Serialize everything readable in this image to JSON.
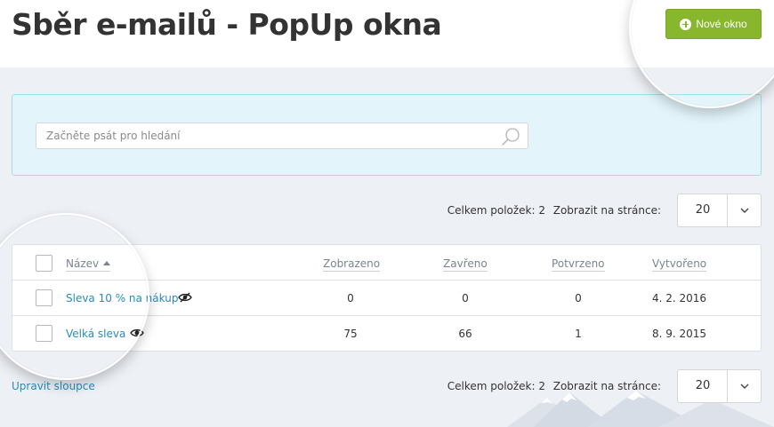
{
  "header": {
    "title": "Sběr e-mailů - PopUp okna",
    "new_button_label": "Nové okno"
  },
  "search": {
    "placeholder": "Začněte psát pro hledání",
    "value": ""
  },
  "pager_top": {
    "total_label": "Celkem položek: 2",
    "per_page_label": "Zobrazit na stránce:",
    "per_page_value": "20"
  },
  "pager_bottom": {
    "total_label": "Celkem položek: 2",
    "per_page_label": "Zobrazit na stránce:",
    "per_page_value": "20"
  },
  "table": {
    "columns": [
      "Název",
      "Zobrazeno",
      "Zavřeno",
      "Potvrzeno",
      "Vytvořeno"
    ],
    "sort_column": "Název",
    "rows": [
      {
        "name": "Sleva 10 % na nákup",
        "visibility_icon": "eye-crossed-icon",
        "shown": "0",
        "closed": "0",
        "confirmed": "0",
        "created": "4. 2. 2016"
      },
      {
        "name": "Velká sleva",
        "visibility_icon": "eye-icon",
        "shown": "75",
        "closed": "66",
        "confirmed": "1",
        "created": "8. 9. 2015"
      }
    ]
  },
  "footer": {
    "edit_columns_label": "Upravit sloupce"
  },
  "colors": {
    "accent_green": "#88b72e",
    "link_blue": "#2a8cb8",
    "search_panel_bg": "#e3f5fb",
    "page_bg": "#edf0f5"
  }
}
